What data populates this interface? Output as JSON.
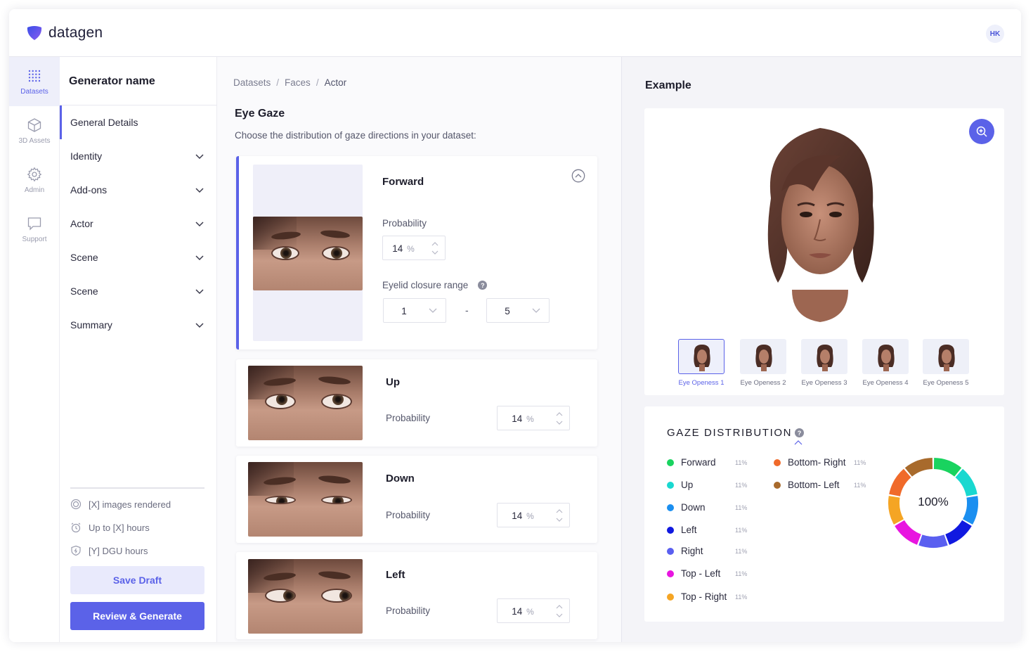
{
  "app": {
    "brand": "datagen",
    "user_initials": "HK"
  },
  "rail": [
    {
      "label": "Datasets",
      "icon": "grid-dots-icon",
      "active": true
    },
    {
      "label": "3D Assets",
      "icon": "cube-icon",
      "active": false
    },
    {
      "label": "Admin",
      "icon": "gear-icon",
      "active": false
    },
    {
      "label": "Support",
      "icon": "chat-bubble-icon",
      "active": false
    }
  ],
  "leftnav": {
    "title": "Generator name",
    "items": [
      {
        "label": "General Details"
      },
      {
        "label": "Identity"
      },
      {
        "label": "Add-ons"
      },
      {
        "label": "Actor"
      },
      {
        "label": "Scene"
      },
      {
        "label": "Scene"
      },
      {
        "label": "Summary"
      }
    ],
    "stats": [
      {
        "label": "[X] images rendered",
        "icon": "images-icon"
      },
      {
        "label": "Up to [X] hours",
        "icon": "alarm-clock-icon"
      },
      {
        "label": "[Y] DGU hours",
        "icon": "shield-icon"
      }
    ],
    "save_label": "Save Draft",
    "review_label": "Review & Generate"
  },
  "breadcrumb": [
    "Datasets",
    "Faces",
    "Actor"
  ],
  "section": {
    "title": "Eye Gaze",
    "subtitle": "Choose the distribution of gaze directions in your dataset:"
  },
  "cards": [
    {
      "title": "Forward",
      "prob_label": "Probability",
      "prob_value": "14",
      "unit": "%",
      "eyelid_label": "Eyelid closure range",
      "range_from": "1",
      "range_sep": "-",
      "range_to": "5"
    },
    {
      "title": "Up",
      "prob_label": "Probability",
      "prob_value": "14",
      "unit": "%"
    },
    {
      "title": "Down",
      "prob_label": "Probability",
      "prob_value": "14",
      "unit": "%"
    },
    {
      "title": "Left",
      "prob_label": "Probability",
      "prob_value": "14",
      "unit": "%"
    }
  ],
  "example": {
    "title": "Example",
    "thumbs": [
      "Eye Openess 1",
      "Eye Openess 2",
      "Eye Openess 3",
      "Eye Openess 4",
      "Eye Openess 5"
    ],
    "active_thumb": 0
  },
  "distribution": {
    "title": "GAZE DISTRIBUTION",
    "help": "?",
    "center_label": "100%",
    "legend": [
      {
        "label": "Forward",
        "pct": "11%",
        "color": "#19d35f"
      },
      {
        "label": "Up",
        "pct": "11%",
        "color": "#19d8d0"
      },
      {
        "label": "Down",
        "pct": "11%",
        "color": "#1b8ff0"
      },
      {
        "label": "Left",
        "pct": "11%",
        "color": "#1019e0"
      },
      {
        "label": "Right",
        "pct": "11%",
        "color": "#5a5ff0"
      },
      {
        "label": "Top - Left",
        "pct": "11%",
        "color": "#e815e0"
      },
      {
        "label": "Top - Right",
        "pct": "11%",
        "color": "#f5a524"
      },
      {
        "label": "Bottom- Right",
        "pct": "11%",
        "color": "#f06a2a"
      },
      {
        "label": "Bottom- Left",
        "pct": "11%",
        "color": "#a86a2c"
      }
    ]
  }
}
